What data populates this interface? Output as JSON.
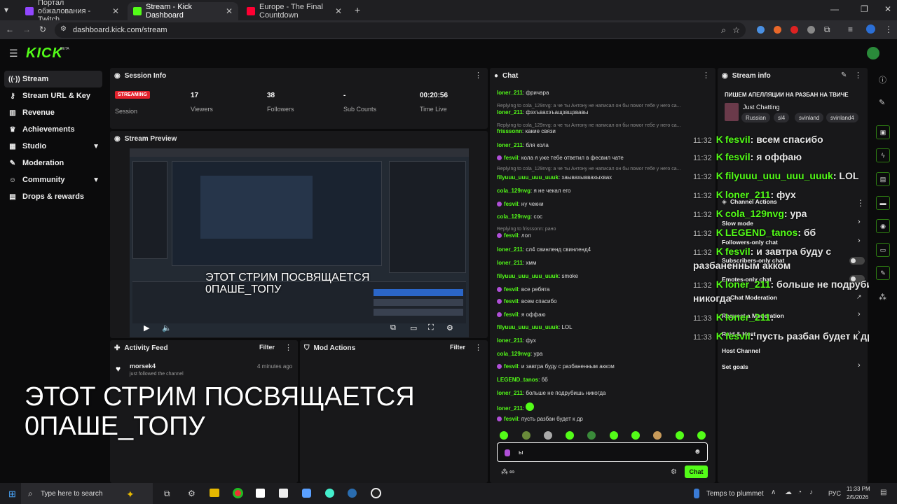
{
  "browser": {
    "tabs": [
      {
        "title": "Портал обжалования - Twitch",
        "color": "#9146ff"
      },
      {
        "title": "Stream - Kick Dashboard",
        "color": "#53fc18"
      },
      {
        "title": "Europe - The Final Countdown",
        "color": "#ff0033"
      }
    ],
    "url": "dashboard.kick.com/stream"
  },
  "app": {
    "logo": "KICK",
    "logo_badge": "BETA"
  },
  "sidebar": {
    "items": [
      {
        "label": "Stream",
        "icon": "broadcast-icon"
      },
      {
        "label": "Stream URL & Key",
        "icon": "key-icon"
      },
      {
        "label": "Revenue",
        "icon": "chart-icon"
      },
      {
        "label": "Achievements",
        "icon": "trophy-icon"
      },
      {
        "label": "Studio",
        "icon": "grid-icon"
      },
      {
        "label": "Moderation",
        "icon": "wrench-icon"
      },
      {
        "label": "Community",
        "icon": "people-icon"
      },
      {
        "label": "Drops & rewards",
        "icon": "gift-icon"
      }
    ]
  },
  "session": {
    "title": "Session Info",
    "badge": "STREAMING",
    "session_label": "Session",
    "stats": [
      {
        "value": "17",
        "label": "Viewers"
      },
      {
        "value": "38",
        "label": "Followers"
      },
      {
        "value": "-",
        "label": "Sub Counts"
      },
      {
        "value": "00:20:56",
        "label": "Time Live"
      }
    ]
  },
  "preview": {
    "title": "Stream Preview",
    "overlay_text": "ЭТОТ СТРИМ ПОСВЯЩАЕТСЯ 0ПАШЕ_ТОПУ"
  },
  "activity": {
    "title": "Activity Feed",
    "filter": "Filter",
    "item_user": "morsek4",
    "item_time": "4 minutes ago",
    "item_text": "just followed the channel"
  },
  "mod": {
    "title": "Mod Actions",
    "filter": "Filter"
  },
  "bigcaption": {
    "line1": "ЭТОТ СТРИМ ПОСВЯЩАЕТСЯ",
    "line2": "0ПАШЕ_ТОПУ"
  },
  "chat": {
    "title": "Chat",
    "input_value": "ы",
    "send_label": "Chat",
    "points": "∞",
    "lines": [
      {
        "user": "loner_211",
        "text": "фричара",
        "badge": "k"
      },
      {
        "reply": "Replying to cola_129nvg: а че ты Антону не написал он бы помог тебе у него са..."
      },
      {
        "user": "loner_211",
        "text": "фэхъвахэъащзвщзвавы",
        "badge": "k"
      },
      {
        "reply": "Replying to cola_129nvg: а че ты Антону не написал он бы помог тебе у него са..."
      },
      {
        "user": "frisssonn",
        "text": "какие связи",
        "badge": "k"
      },
      {
        "user": "loner_211",
        "text": "бля кола",
        "badge": "k"
      },
      {
        "user": "fesvil",
        "text": "кола я уже тебе ответил в фесвил чате",
        "badge": "m"
      },
      {
        "reply": "Replying to cola_129nvg: а че ты Антону не написал он бы помог тебе у него са..."
      },
      {
        "user": "filyuuu_uuu_uuu_uuuk",
        "text": "хаывахыввахыхвах",
        "badge": "k"
      },
      {
        "user": "cola_129nvg",
        "text": "я не чекал его",
        "badge": "k"
      },
      {
        "user": "fesvil",
        "text": "ну чекни",
        "badge": "m"
      },
      {
        "user": "cola_129nvg",
        "text": "сос",
        "badge": "k"
      },
      {
        "reply": "Replying to frisssonn: рано"
      },
      {
        "user": "fesvil",
        "text": "лол",
        "badge": "m"
      },
      {
        "user": "loner_211",
        "text": "сл4 свинленд свинленд4",
        "badge": "k"
      },
      {
        "user": "loner_211",
        "text": "хмм",
        "badge": "k"
      },
      {
        "user": "filyuuu_uuu_uuu_uuuk",
        "text": "smoke",
        "badge": "k"
      },
      {
        "user": "fesvil",
        "text": "все ребята",
        "badge": "m"
      },
      {
        "user": "fesvil",
        "text": "всем спасибо",
        "badge": "m"
      },
      {
        "user": "fesvil",
        "text": "я оффаю",
        "badge": "m"
      },
      {
        "user": "filyuuu_uuu_uuu_uuuk",
        "text": "LOL",
        "badge": "k"
      },
      {
        "user": "loner_211",
        "text": "фух",
        "badge": "k"
      },
      {
        "user": "cola_129nvg",
        "text": "ура",
        "badge": "k"
      },
      {
        "user": "fesvil",
        "text": "и завтра буду с разбаненным акком",
        "badge": "m"
      },
      {
        "user": "LEGEND_tanos",
        "text": "бб",
        "badge": "k"
      },
      {
        "user": "loner_211",
        "text": "больше не подрубишь никогда",
        "badge": "k"
      },
      {
        "user": "loner_211",
        "text": "",
        "badge": "k"
      },
      {
        "user": "fesvil",
        "text": "пусть разбан будет к др",
        "badge": "m"
      }
    ]
  },
  "overlay_chat": [
    {
      "time": "11:32",
      "user": "fesvil",
      "text": "всем спасибо"
    },
    {
      "time": "11:32",
      "user": "fesvil",
      "text": "я оффаю"
    },
    {
      "time": "11:32",
      "user": "filyuuu_uuu_uuu_uuuk",
      "text": "LOL"
    },
    {
      "time": "11:32",
      "user": "loner_211",
      "text": "фух"
    },
    {
      "time": "11:32",
      "user": "cola_129nvg",
      "text": "ура"
    },
    {
      "time": "11:32",
      "user": "LEGEND_tanos",
      "text": "бб"
    },
    {
      "time": "11:32",
      "user": "fesvil",
      "text": "и завтра буду с"
    },
    {
      "time": "",
      "user": "",
      "text": "разбаненным акком"
    },
    {
      "time": "11:32",
      "user": "loner_211",
      "text": "больше не подрубишь"
    },
    {
      "time": "",
      "user": "",
      "text": "никогда"
    },
    {
      "time": "11:33",
      "user": "loner_211",
      "text": ""
    },
    {
      "time": "11:33",
      "user": "fesvil",
      "text": "пусть разбан будет к др"
    }
  ],
  "streaminfo": {
    "title": "Stream info",
    "stream_title": "ПИШЕМ АПЕЛЛЯЦИИ НА РАЗБАН НА ТВИЧЕ",
    "category": "Just Chatting",
    "tags": [
      "Russian",
      "sl4",
      "svinland",
      "svinland4"
    ]
  },
  "channel_actions": {
    "title": "Channel Actions",
    "items": [
      "Slow mode",
      "Followers-only chat",
      "Subscribers-only chat",
      "Emotes-only chat",
      "Chat Moderation",
      "Request a Moderation",
      "Raid & Host",
      "Host Channel",
      "Set goals"
    ]
  },
  "taskbar": {
    "search": "Type here to search",
    "weather": "Temps to plummet",
    "lang": "РУС",
    "time": "11:33 PM",
    "date": "2/5/2026"
  }
}
